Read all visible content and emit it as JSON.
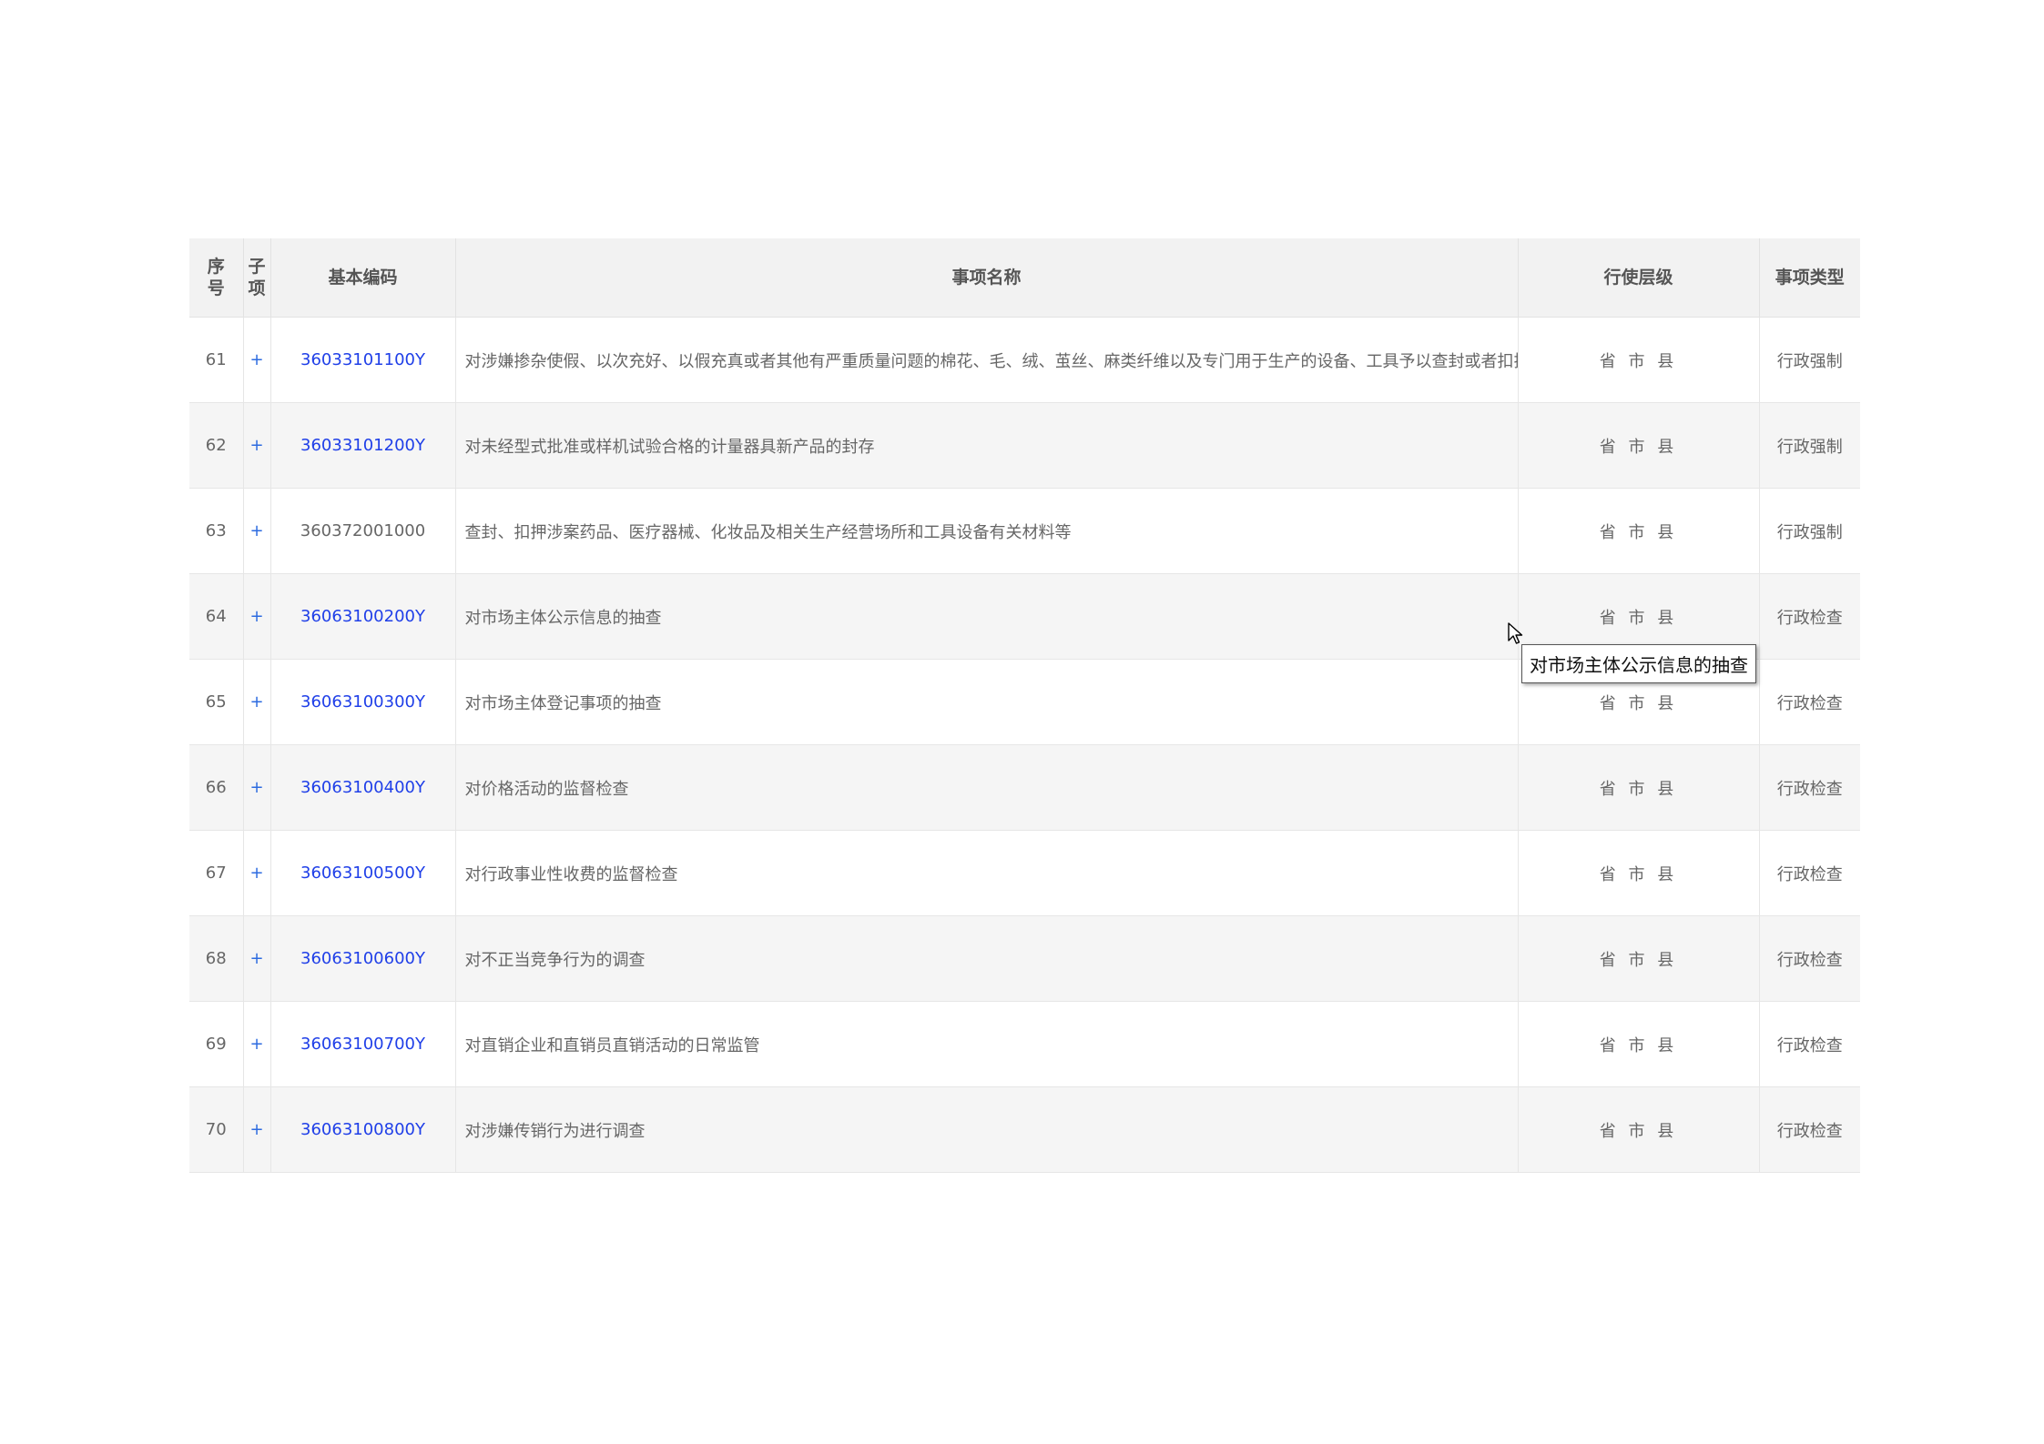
{
  "table": {
    "headers": {
      "seq_line1": "序",
      "seq_line2": "号",
      "sub_line1": "子",
      "sub_line2": "项",
      "code": "基本编码",
      "name": "事项名称",
      "level": "行使层级",
      "type": "事项类型"
    },
    "rows": [
      {
        "seq": "61",
        "sub": "+",
        "code": "36033101100Y",
        "code_link": true,
        "name": "对涉嫌掺杂使假、以次充好、以假充真或者其他有严重质量问题的棉花、毛、绒、茧丝、麻类纤维以及专门用于生产的设备、工具予以查封或者扣押",
        "level": "省 市 县",
        "type": "行政强制"
      },
      {
        "seq": "62",
        "sub": "+",
        "code": "36033101200Y",
        "code_link": true,
        "name": "对未经型式批准或样机试验合格的计量器具新产品的封存",
        "level": "省 市 县",
        "type": "行政强制"
      },
      {
        "seq": "63",
        "sub": "+",
        "code": "360372001000",
        "code_link": false,
        "name": "查封、扣押涉案药品、医疗器械、化妆品及相关生产经营场所和工具设备有关材料等",
        "level": "省 市 县",
        "type": "行政强制"
      },
      {
        "seq": "64",
        "sub": "+",
        "code": "36063100200Y",
        "code_link": true,
        "name": "对市场主体公示信息的抽查",
        "level": "省 市 县",
        "type": "行政检查"
      },
      {
        "seq": "65",
        "sub": "+",
        "code": "36063100300Y",
        "code_link": true,
        "name": "对市场主体登记事项的抽查",
        "level": "省 市 县",
        "type": "行政检查"
      },
      {
        "seq": "66",
        "sub": "+",
        "code": "36063100400Y",
        "code_link": true,
        "name": "对价格活动的监督检查",
        "level": "省 市 县",
        "type": "行政检查"
      },
      {
        "seq": "67",
        "sub": "+",
        "code": "36063100500Y",
        "code_link": true,
        "name": "对行政事业性收费的监督检查",
        "level": "省 市 县",
        "type": "行政检查"
      },
      {
        "seq": "68",
        "sub": "+",
        "code": "36063100600Y",
        "code_link": true,
        "name": "对不正当竞争行为的调查",
        "level": "省 市 县",
        "type": "行政检查"
      },
      {
        "seq": "69",
        "sub": "+",
        "code": "36063100700Y",
        "code_link": true,
        "name": "对直销企业和直销员直销活动的日常监管",
        "level": "省 市 县",
        "type": "行政检查"
      },
      {
        "seq": "70",
        "sub": "+",
        "code": "36063100800Y",
        "code_link": true,
        "name": "对涉嫌传销行为进行调查",
        "level": "省 市 县",
        "type": "行政检查"
      }
    ]
  },
  "tooltip": {
    "text": "对市场主体公示信息的抽查"
  },
  "icons": {
    "cursor": "mouse-pointer-icon"
  }
}
